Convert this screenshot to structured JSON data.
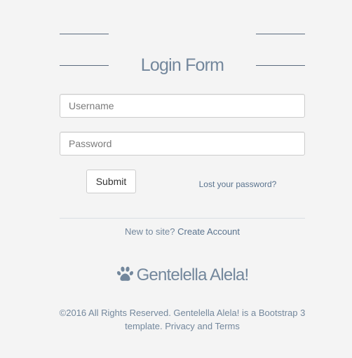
{
  "form": {
    "title": "Login Form",
    "username_placeholder": "Username",
    "username_value": "",
    "password_placeholder": "Password",
    "password_value": "",
    "submit_label": "Submit",
    "lost_password_label": "Lost your password?"
  },
  "signup": {
    "prompt": "New to site?",
    "link_label": "Create Account"
  },
  "footer": {
    "brand_icon": "paw-icon",
    "brand_name": "Gentelella Alela!",
    "copyright": "©2016 All Rights Reserved. Gentelella Alela! is a Bootstrap 3 template. Privacy and Terms"
  },
  "colors": {
    "background": "#F4F4F4",
    "heading": "#73879C",
    "link": "#5A738E"
  }
}
